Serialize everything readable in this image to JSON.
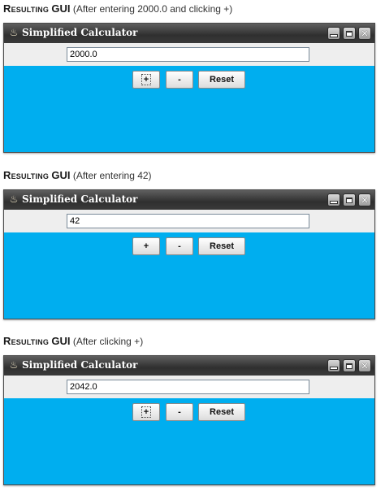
{
  "panels": [
    {
      "caption": {
        "lead": "Resulting",
        "gui": "GUI",
        "rest": " (After entering 2000.0 and clicking +)"
      },
      "window": {
        "title": "Simplified Calculator",
        "field_value": "2000.0",
        "buttons": {
          "plus": "+",
          "minus": "-",
          "reset": "Reset"
        },
        "focused_button": "plus"
      }
    },
    {
      "caption": {
        "lead": "Resulting",
        "gui": "GUI",
        "rest": " (After entering 42)"
      },
      "window": {
        "title": "Simplified Calculator",
        "field_value": "42",
        "buttons": {
          "plus": "+",
          "minus": "-",
          "reset": "Reset"
        },
        "focused_button": ""
      }
    },
    {
      "caption": {
        "lead": "Resulting",
        "gui": "GUI",
        "rest": " (After clicking +)"
      },
      "window": {
        "title": "Simplified Calculator",
        "field_value": "2042.0",
        "buttons": {
          "plus": "+",
          "minus": "-",
          "reset": "Reset"
        },
        "focused_button": "plus"
      }
    }
  ],
  "icons": {
    "app": "java-cup-icon",
    "minimize": "minimize-icon",
    "maximize": "maximize-icon",
    "close": "close-icon"
  },
  "colors": {
    "content_background": "#00aeef",
    "titlebar": "#3a3a3a",
    "input_panel": "#eeeeee"
  }
}
